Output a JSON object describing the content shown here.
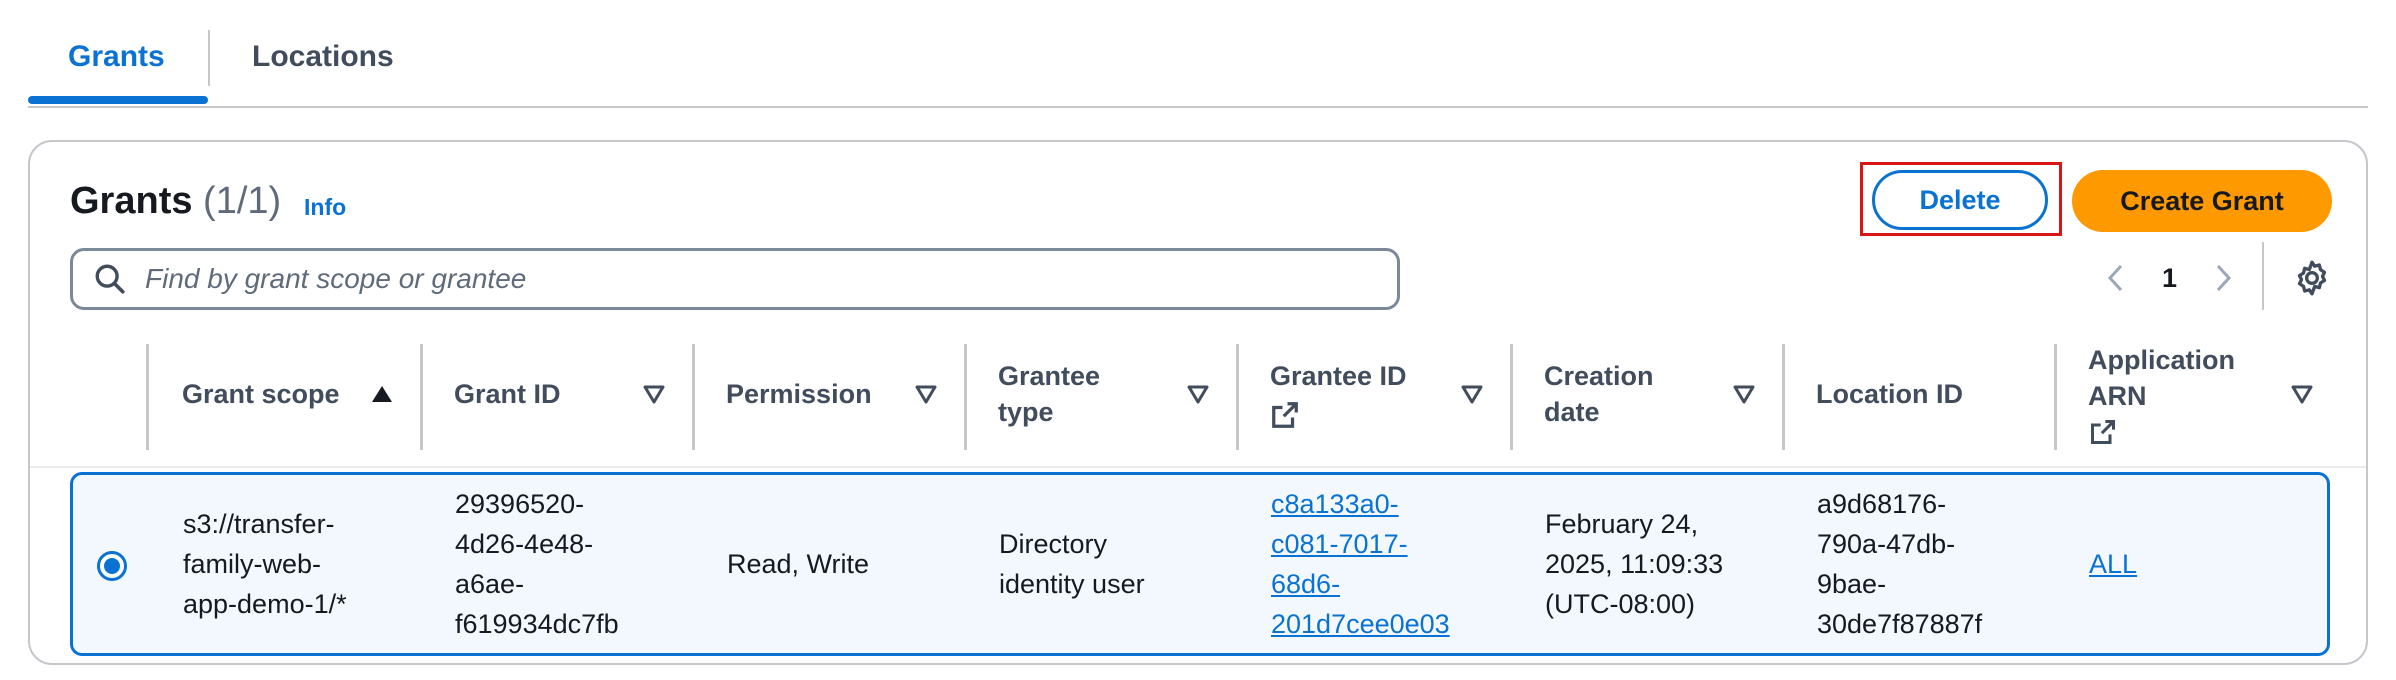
{
  "tabs": [
    {
      "label": "Grants",
      "active": true
    },
    {
      "label": "Locations",
      "active": false
    }
  ],
  "header": {
    "title": "Grants",
    "count": "(1/1)",
    "info_label": "Info"
  },
  "actions": {
    "delete_label": "Delete",
    "create_label": "Create Grant"
  },
  "search": {
    "placeholder": "Find by grant scope or grantee"
  },
  "pagination": {
    "current_page": "1"
  },
  "table": {
    "columns": [
      {
        "label": "Grant scope"
      },
      {
        "label": "Grant ID"
      },
      {
        "label": "Permission"
      },
      {
        "label": "Grantee\ntype"
      },
      {
        "label": "Grantee ID"
      },
      {
        "label": "Creation\ndate"
      },
      {
        "label": "Location ID"
      },
      {
        "label": "Application\nARN"
      }
    ],
    "rows": [
      {
        "selected": true,
        "grant_scope": "s3://transfer-\nfamily-web-\napp-demo-1/*",
        "grant_id": "29396520-\n4d26-4e48-\na6ae-\nf619934dc7fb",
        "permission": "Read, Write",
        "grantee_type": "Directory\nidentity user",
        "grantee_id": "c8a133a0-\nc081-7017-\n68d6-\n201d7cee0e03",
        "creation_date": "February 24,\n2025, 11:09:33\n(UTC-08:00)",
        "location_id": "a9d68176-\n790a-47db-\n9bae-\n30de7f87887f",
        "application_arn": "ALL"
      }
    ]
  },
  "colors": {
    "accent": "#0972d3",
    "primary_button": "#ff9900",
    "highlight": "#d91515",
    "selected_row_bg": "#f2f8fd"
  }
}
